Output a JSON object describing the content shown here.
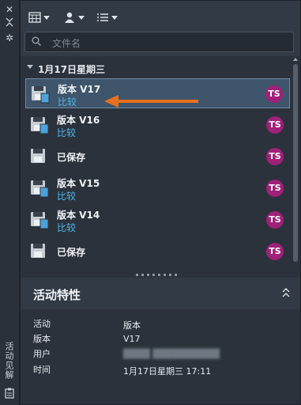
{
  "sidebar": {
    "title": "活动见解",
    "icons": [
      "close-icon",
      "pin-icon",
      "settings-icon",
      "clipboard-icon"
    ]
  },
  "toolbar": {
    "buttons": [
      "calendar-icon",
      "user-icon",
      "list-icon"
    ]
  },
  "search": {
    "placeholder": "文件名"
  },
  "group": {
    "label": "1月17日星期三"
  },
  "rows": [
    {
      "title": "版本 V17",
      "link": "比较",
      "avatar": "TS",
      "selected": true
    },
    {
      "title": "版本 V16",
      "link": "比较",
      "avatar": "TS",
      "selected": false
    },
    {
      "title": "已保存",
      "link": "",
      "avatar": "TS",
      "selected": false
    },
    {
      "title": "版本 V15",
      "link": "比较",
      "avatar": "TS",
      "selected": false
    },
    {
      "title": "版本 V14",
      "link": "比较",
      "avatar": "TS",
      "selected": false
    },
    {
      "title": "已保存",
      "link": "",
      "avatar": "TS",
      "selected": false
    }
  ],
  "properties": {
    "title": "活动特性",
    "items": [
      {
        "label": "活动",
        "value": "版本"
      },
      {
        "label": "版本",
        "value": "V17"
      },
      {
        "label": "用户",
        "value": ""
      },
      {
        "label": "时间",
        "value": "1月17日星期三 17:11"
      }
    ]
  },
  "colors": {
    "accent_arrow": "#e8711f",
    "link": "#4fb6ea",
    "avatar": "#a0207a",
    "selection": "#3e556b"
  }
}
